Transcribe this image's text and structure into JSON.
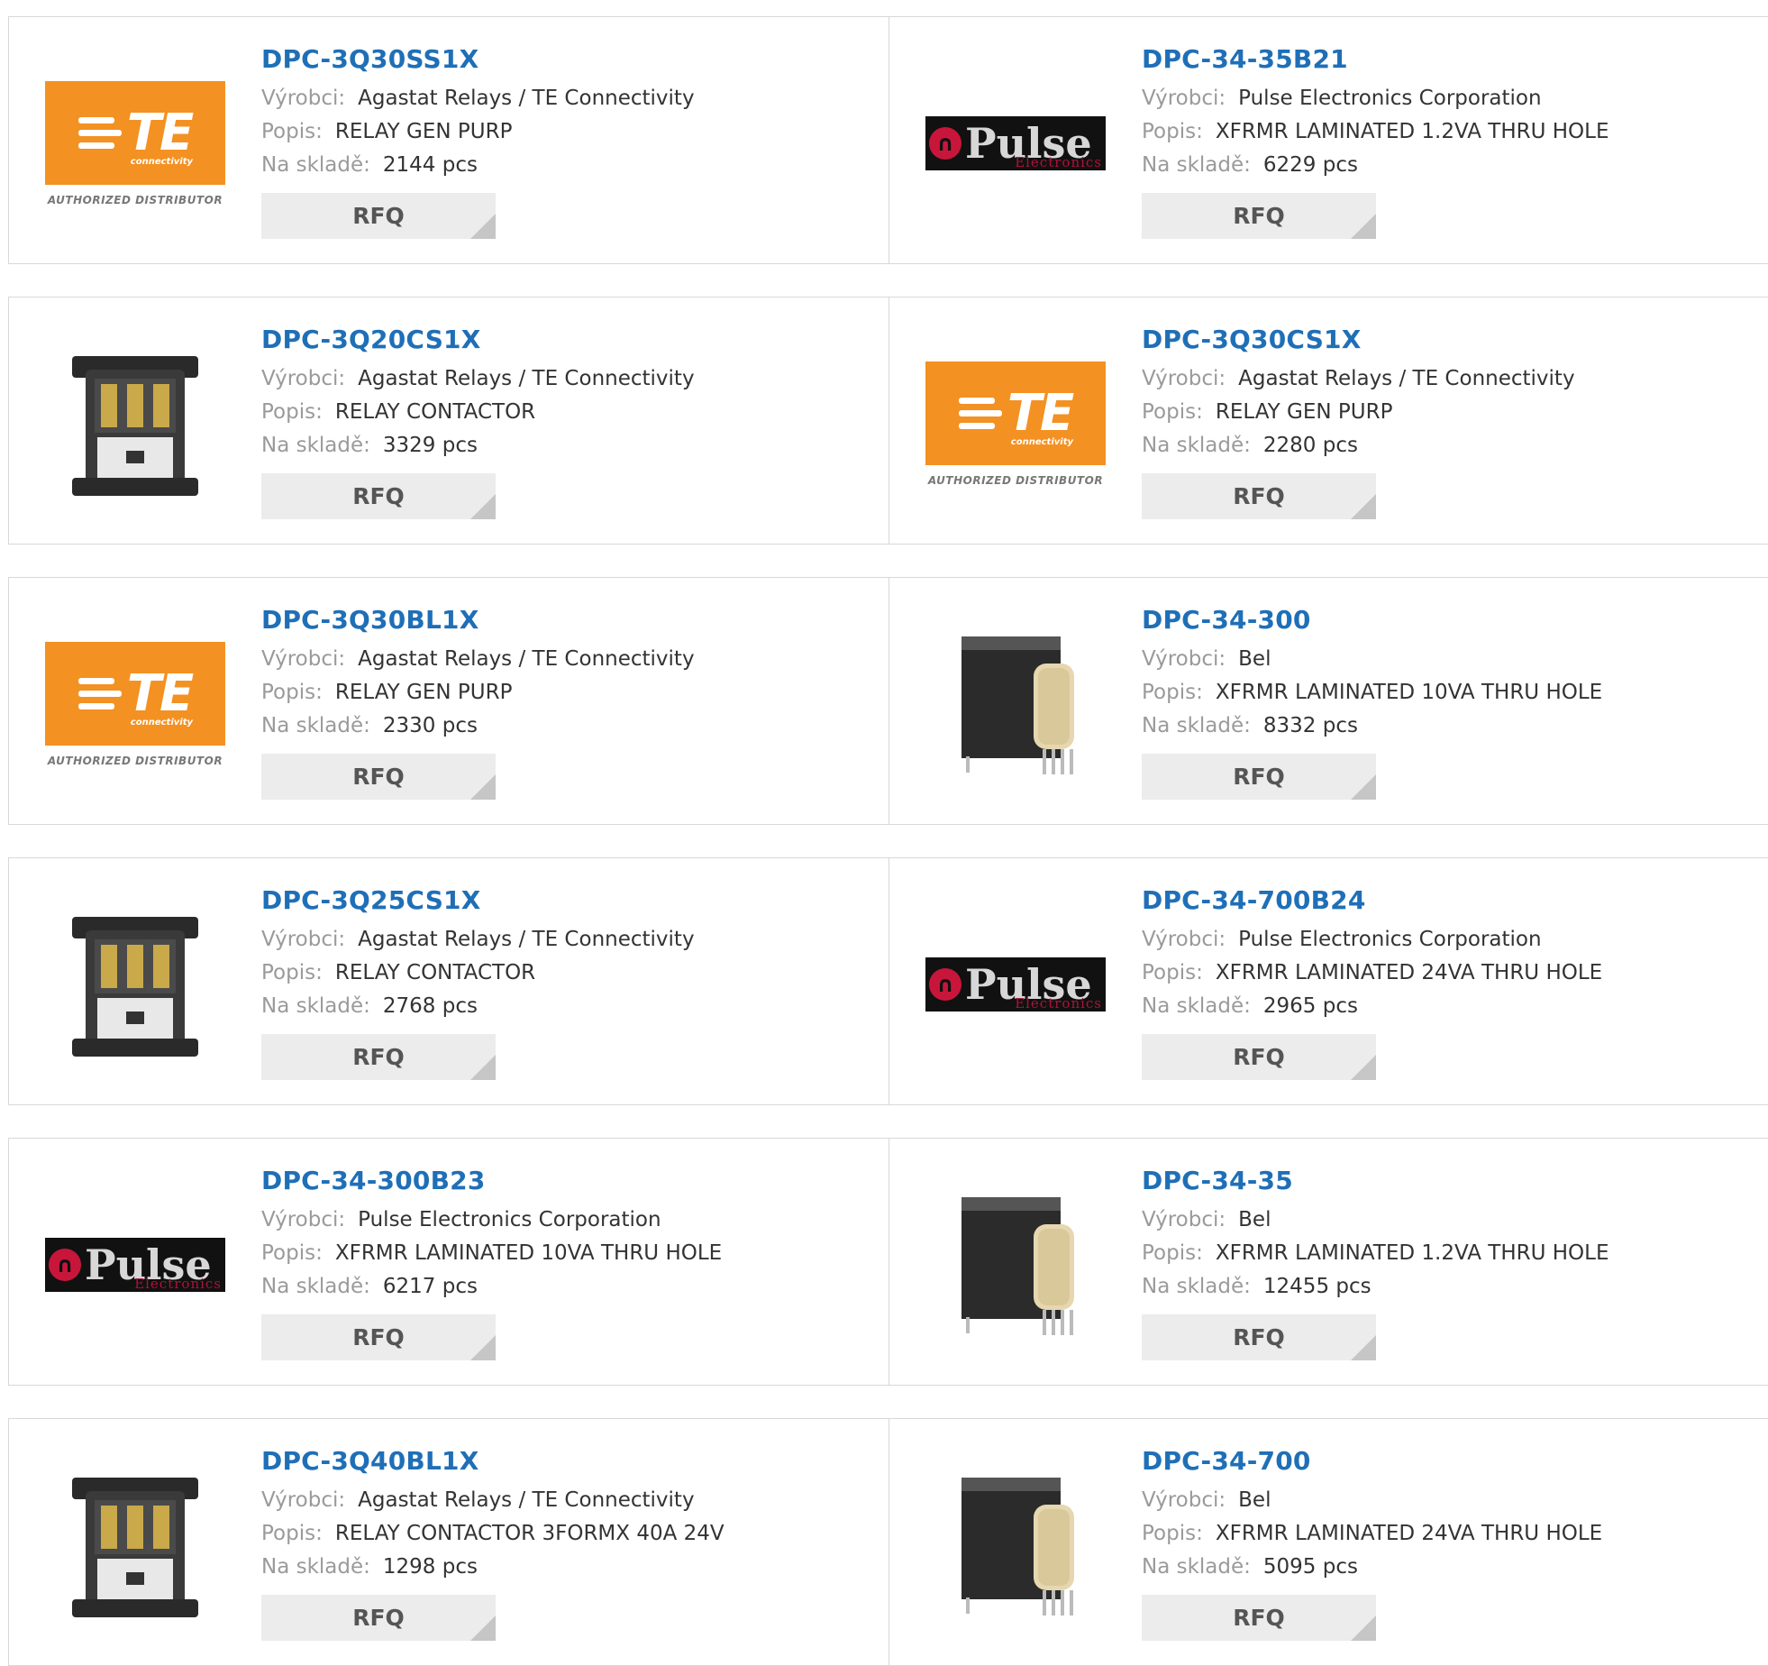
{
  "labels": {
    "manufacturer": "Výrobci:",
    "description": "Popis:",
    "stock": "Na skladě:",
    "rfq": "RFQ"
  },
  "logos": {
    "te_auth": "AUTHORIZED DISTRIBUTOR",
    "te_word": "TE",
    "te_sub": "connectivity",
    "pulse_word": "Pulse",
    "pulse_sub": "Electronics"
  },
  "colors": {
    "link": "#1f6fb7",
    "te_orange": "#f39122",
    "pulse_red": "#c8163b"
  },
  "products": [
    {
      "pn": "DPC-3Q30SS1X",
      "mfr": "Agastat Relays / TE Connectivity",
      "desc": "RELAY GEN PURP",
      "stock": "2144 pcs",
      "image": "te-logo"
    },
    {
      "pn": "DPC-34-35B21",
      "mfr": "Pulse Electronics Corporation",
      "desc": "XFRMR LAMINATED 1.2VA THRU HOLE",
      "stock": "6229 pcs",
      "image": "pulse-logo"
    },
    {
      "pn": "DPC-3Q20CS1X",
      "mfr": "Agastat Relays / TE Connectivity",
      "desc": "RELAY CONTACTOR",
      "stock": "3329 pcs",
      "image": "contactor"
    },
    {
      "pn": "DPC-3Q30CS1X",
      "mfr": "Agastat Relays / TE Connectivity",
      "desc": "RELAY GEN PURP",
      "stock": "2280 pcs",
      "image": "te-logo"
    },
    {
      "pn": "DPC-3Q30BL1X",
      "mfr": "Agastat Relays / TE Connectivity",
      "desc": "RELAY GEN PURP",
      "stock": "2330 pcs",
      "image": "te-logo"
    },
    {
      "pn": "DPC-34-300",
      "mfr": "Bel",
      "desc": "XFRMR LAMINATED 10VA THRU HOLE",
      "stock": "8332 pcs",
      "image": "transformer"
    },
    {
      "pn": "DPC-3Q25CS1X",
      "mfr": "Agastat Relays / TE Connectivity",
      "desc": "RELAY CONTACTOR",
      "stock": "2768 pcs",
      "image": "contactor"
    },
    {
      "pn": "DPC-34-700B24",
      "mfr": "Pulse Electronics Corporation",
      "desc": "XFRMR LAMINATED 24VA THRU HOLE",
      "stock": "2965 pcs",
      "image": "pulse-logo"
    },
    {
      "pn": "DPC-34-300B23",
      "mfr": "Pulse Electronics Corporation",
      "desc": "XFRMR LAMINATED 10VA THRU HOLE",
      "stock": "6217 pcs",
      "image": "pulse-logo"
    },
    {
      "pn": "DPC-34-35",
      "mfr": "Bel",
      "desc": "XFRMR LAMINATED 1.2VA THRU HOLE",
      "stock": "12455 pcs",
      "image": "transformer"
    },
    {
      "pn": "DPC-3Q40BL1X",
      "mfr": "Agastat Relays / TE Connectivity",
      "desc": "RELAY CONTACTOR 3FORMX 40A 24V",
      "stock": "1298 pcs",
      "image": "contactor"
    },
    {
      "pn": "DPC-34-700",
      "mfr": "Bel",
      "desc": "XFRMR LAMINATED 24VA THRU HOLE",
      "stock": "5095 pcs",
      "image": "transformer"
    }
  ]
}
